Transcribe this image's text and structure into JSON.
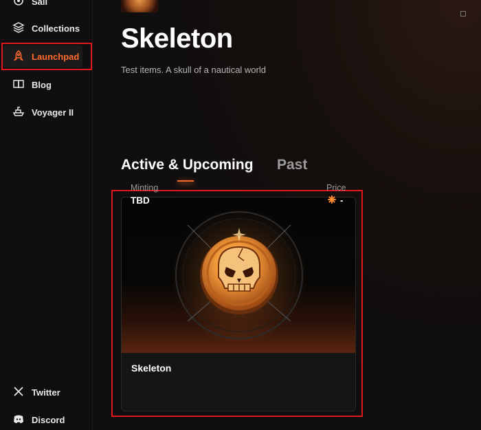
{
  "sidebar": {
    "items": [
      {
        "label": "Sail",
        "icon": "sail-icon"
      },
      {
        "label": "Collections",
        "icon": "collections-icon"
      },
      {
        "label": "Launchpad",
        "icon": "rocket-icon",
        "active": true
      },
      {
        "label": "Blog",
        "icon": "book-icon"
      },
      {
        "label": "Voyager II",
        "icon": "ship-icon"
      }
    ],
    "footer": [
      {
        "label": "Twitter",
        "icon": "x-icon"
      },
      {
        "label": "Discord",
        "icon": "discord-icon"
      }
    ]
  },
  "collection": {
    "title": "Skeleton",
    "subtitle": "Test items. A skull of a nautical world"
  },
  "tabs": [
    {
      "label": "Active & Upcoming",
      "active": true
    },
    {
      "label": "Past",
      "active": false
    }
  ],
  "card": {
    "name": "Skeleton",
    "status_label": "Minting",
    "status_value": "TBD",
    "price_label": "Price",
    "price_value": "-"
  },
  "colors": {
    "accent": "#ff6b2c",
    "highlight_box": "#e2161b",
    "background": "#0e0e0e"
  }
}
